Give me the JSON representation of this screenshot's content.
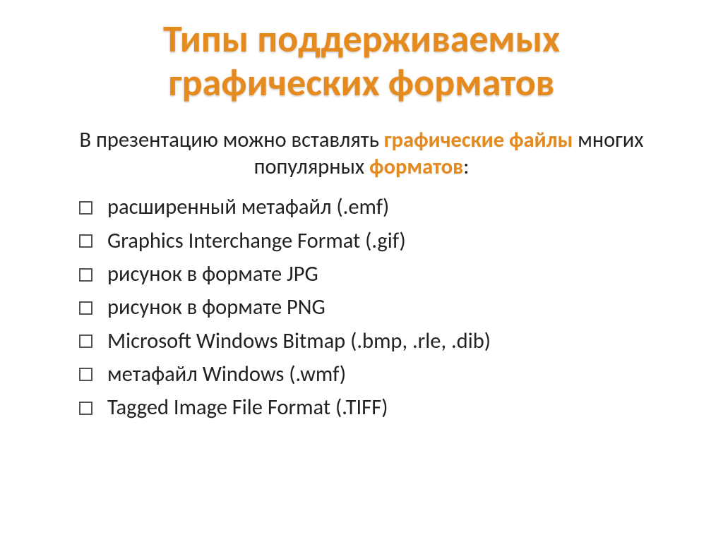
{
  "title_line1": "Типы поддерживаемых",
  "title_line2": "графических форматов",
  "intro": {
    "t1": "В презентацию можно вставлять ",
    "a1": "графические файлы",
    "t2": " многих популярных ",
    "a2": "форматов",
    "t3": ":"
  },
  "items": [
    "расширенный метафайл (.emf)",
    "Graphics Interchange Format (.gif)",
    "рисунок в формате JPG",
    "рисунок в формате PNG",
    "Microsoft Windows Bitmap (.bmp, .rle, .dib)",
    "метафайл Windows (.wmf)",
    "Tagged Image File Format (.TIFF)"
  ]
}
